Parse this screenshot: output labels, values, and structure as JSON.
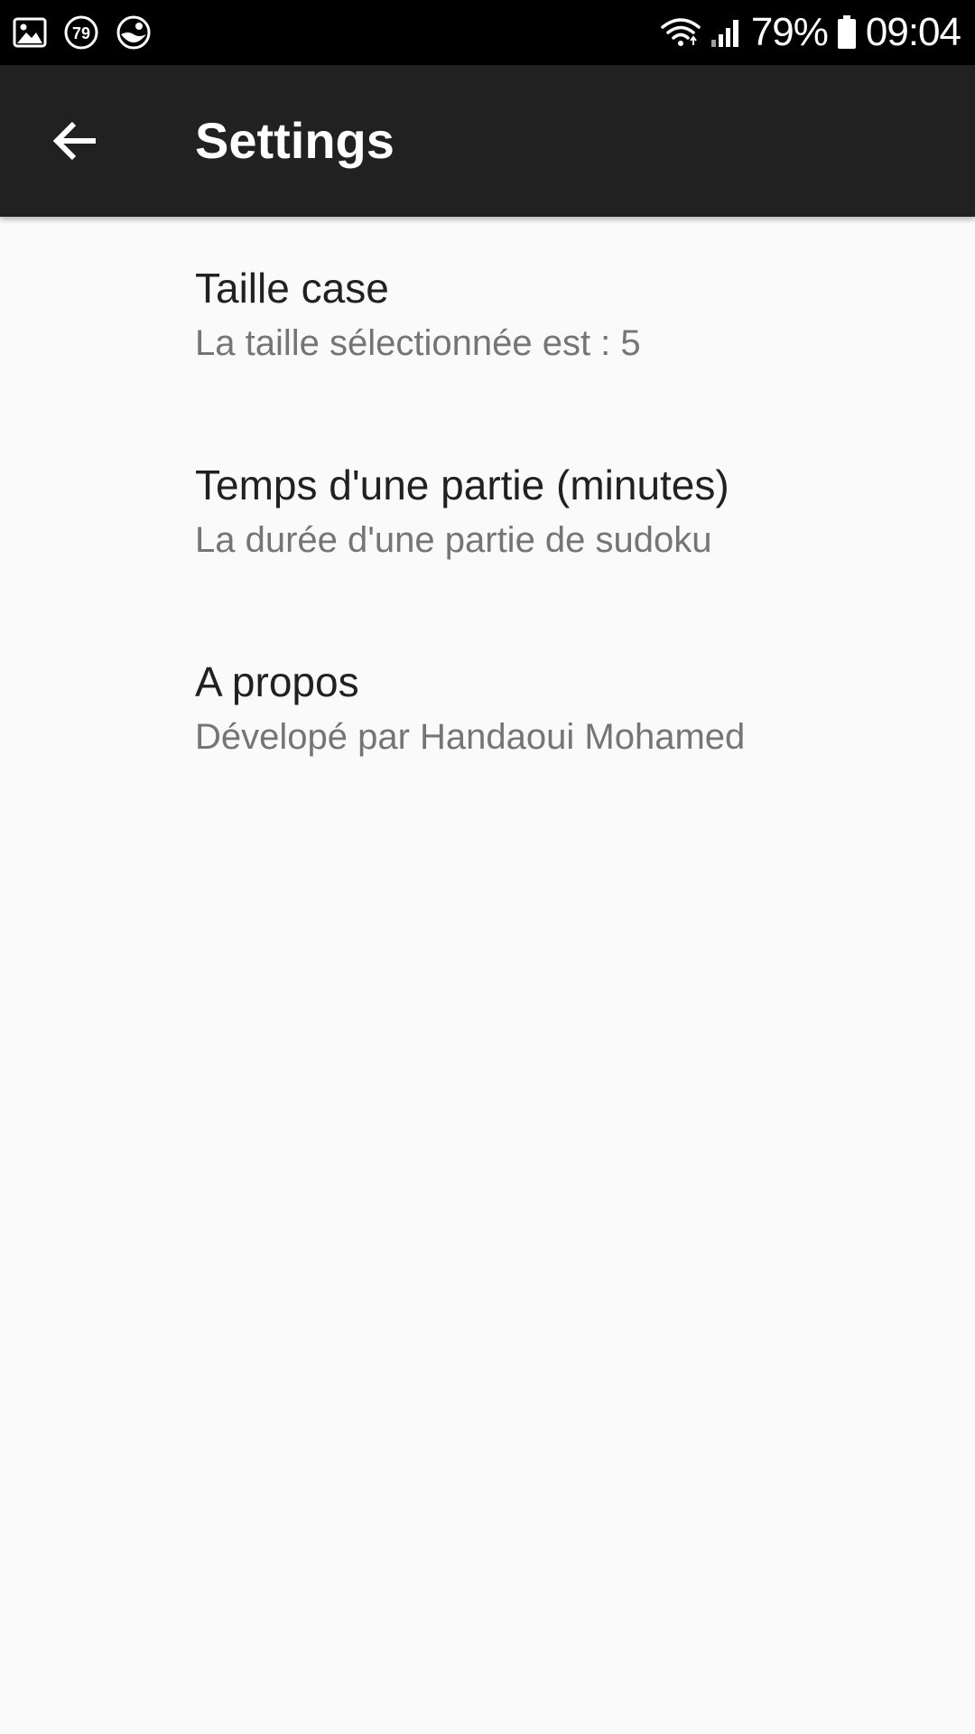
{
  "status_bar": {
    "left_icons": [
      "gallery-icon",
      "badge-79-icon",
      "app-notification-icon"
    ],
    "badge_number": "79",
    "battery_percent": "79%",
    "time": "09:04"
  },
  "app_bar": {
    "title": "Settings",
    "back_icon": "arrow-left-icon"
  },
  "settings": [
    {
      "title": "Taille case",
      "summary": "La taille sélectionnée est : 5"
    },
    {
      "title": "Temps d'une partie (minutes)",
      "summary": "La durée d'une partie de sudoku"
    },
    {
      "title": "A propos",
      "summary": "Dévelopé par Handaoui Mohamed"
    }
  ],
  "colors": {
    "status_bar": "#000000",
    "app_bar": "#212121",
    "background": "#fafafa",
    "title_text": "#212121",
    "summary_text": "#757575"
  }
}
